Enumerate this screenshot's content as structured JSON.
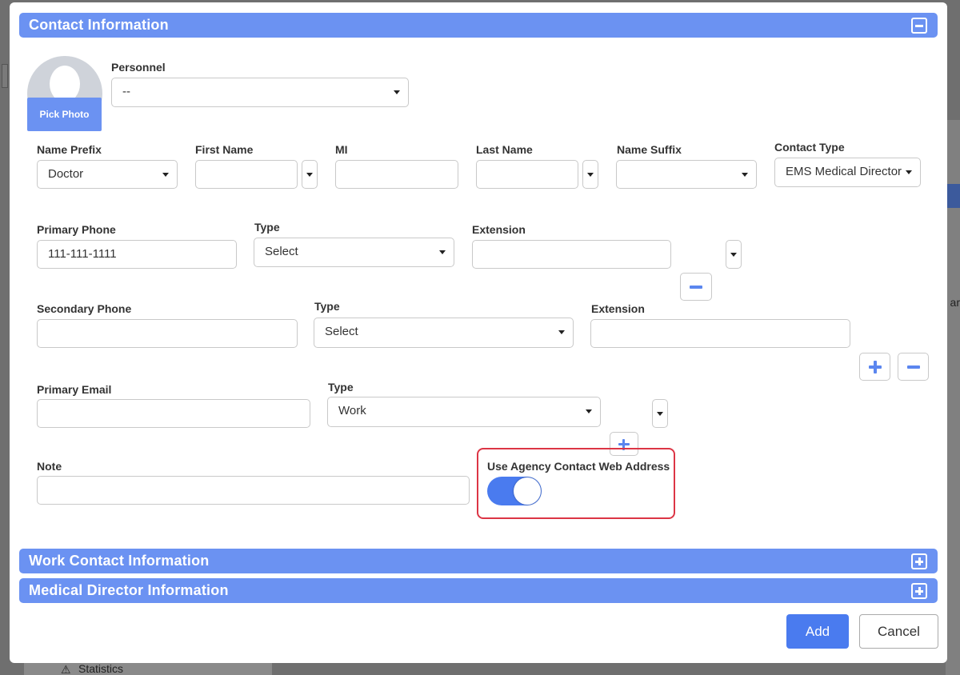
{
  "background": {
    "right_partial_text": "ar",
    "bottom_tab_label": "Statistics"
  },
  "sections": {
    "contact_info_title": "Contact Information",
    "work_contact_title": "Work Contact Information",
    "medical_director_title": "Medical Director Information"
  },
  "photo": {
    "pick_label": "Pick Photo"
  },
  "personnel": {
    "label": "Personnel",
    "value": "--"
  },
  "name_row": {
    "prefix_label": "Name Prefix",
    "prefix_value": "Doctor",
    "first_label": "First Name",
    "first_value": "",
    "mi_label": "MI",
    "mi_value": "",
    "last_label": "Last Name",
    "last_value": "",
    "suffix_label": "Name Suffix",
    "suffix_value": "",
    "contact_type_label": "Contact Type",
    "contact_type_value": "EMS Medical Director"
  },
  "primary_phone": {
    "label": "Primary Phone",
    "value": "111-111-1111",
    "type_label": "Type",
    "type_value": "Select",
    "extension_label": "Extension",
    "extension_value": ""
  },
  "secondary_phone": {
    "label": "Secondary Phone",
    "value": "",
    "type_label": "Type",
    "type_value": "Select",
    "extension_label": "Extension",
    "extension_value": ""
  },
  "primary_email": {
    "label": "Primary Email",
    "value": "",
    "type_label": "Type",
    "type_value": "Work"
  },
  "note": {
    "label": "Note",
    "value": ""
  },
  "web_address_toggle": {
    "label": "Use Agency Contact Web Address",
    "state": "on"
  },
  "footer": {
    "add_label": "Add",
    "cancel_label": "Cancel"
  },
  "colors": {
    "section_bar": "#6b92f2",
    "primary": "#4a7bef",
    "highlight": "#dc3545"
  }
}
